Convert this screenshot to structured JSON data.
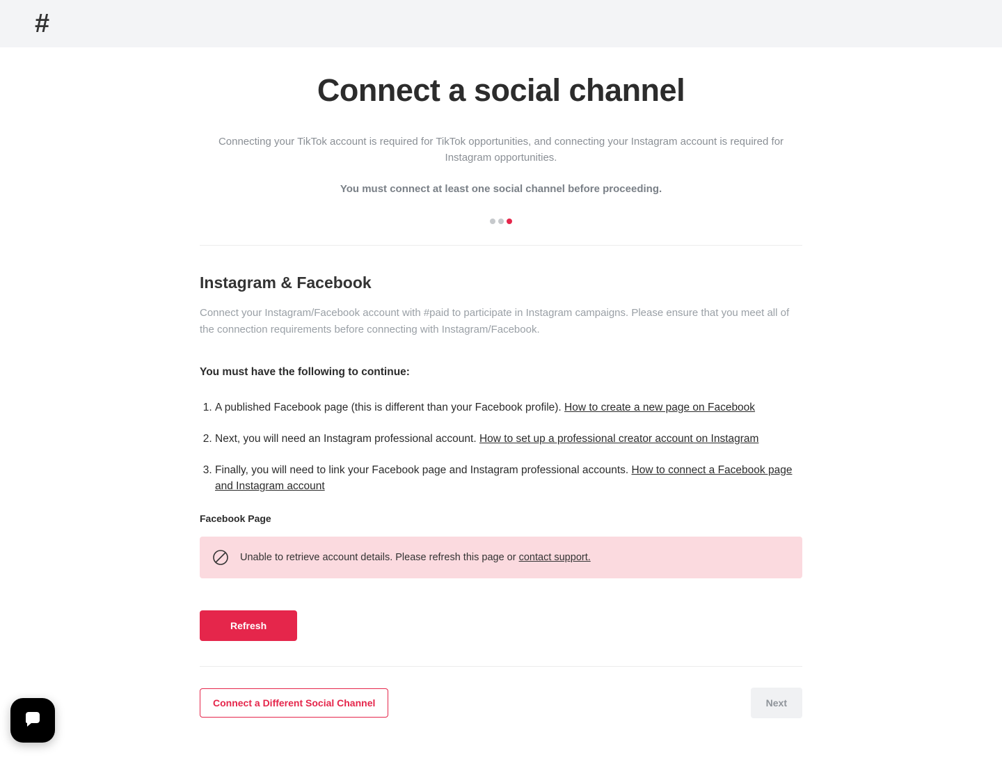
{
  "header": {
    "logo": "#"
  },
  "page": {
    "title": "Connect a social channel",
    "intro": "Connecting your TikTok account is required for TikTok opportunities, and connecting your Instagram account is required for Instagram opportunities.",
    "intro_bold": "You must connect at least one social channel before proceeding.",
    "progress": {
      "total": 3,
      "active_index": 2
    }
  },
  "section": {
    "title": "Instagram & Facebook",
    "desc": "Connect your Instagram/Facebook account with #paid to participate in Instagram campaigns. Please ensure that you meet all of the connection requirements before connecting with Instagram/Facebook.",
    "must_have_label": "You must have the following to continue:",
    "requirements": [
      {
        "text": "A published Facebook page (this is different than your Facebook profile). ",
        "link": "How to create a new page on Facebook"
      },
      {
        "text": "Next, you will need an Instagram professional account. ",
        "link": "How to set up a professional creator account on Instagram"
      },
      {
        "text": "Finally, you will need to link your Facebook page and Instagram professional accounts. ",
        "link": "How to connect a Facebook page and Instagram account"
      }
    ],
    "field_label": "Facebook Page",
    "error": {
      "message_pre": "Unable to retrieve account details. Please refresh this page or ",
      "support_link": "contact support."
    },
    "refresh_label": "Refresh"
  },
  "footer": {
    "connect_other_label": "Connect a Different Social Channel",
    "next_label": "Next"
  }
}
